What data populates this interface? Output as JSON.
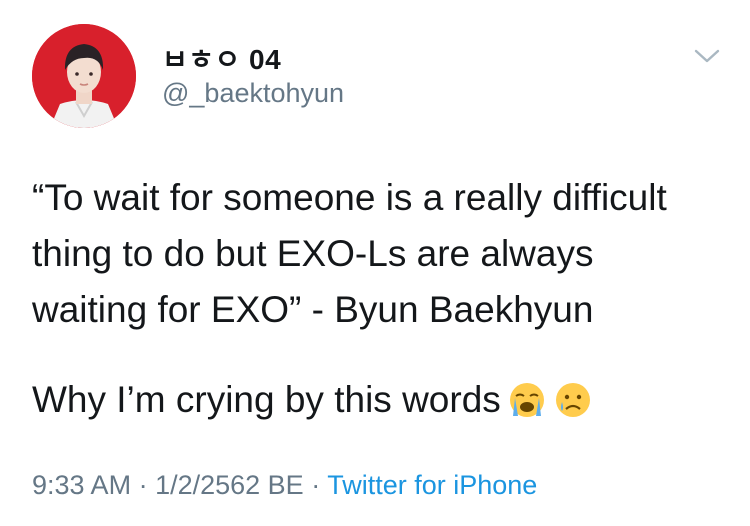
{
  "tweet": {
    "display_name": "ㅂㅎㅇ 04",
    "handle": "@_baektohyun",
    "text_lines": [
      "“To wait for someone is a really difficult",
      "thing to do but EXO-Ls are always",
      "waiting for EXO” - Byun Baekhyun"
    ],
    "second_paragraph": "Why I’m crying by this words",
    "emojis": [
      "loudly-crying-face-icon",
      "crying-face-icon"
    ],
    "time": "9:33 AM",
    "separator": " · ",
    "date": "1/2/2562 BE",
    "source": "Twitter for iPhone"
  },
  "colors": {
    "text": "#14171a",
    "muted": "#657786",
    "link": "#1b95e0",
    "avatar_bg": "#d8202c"
  }
}
